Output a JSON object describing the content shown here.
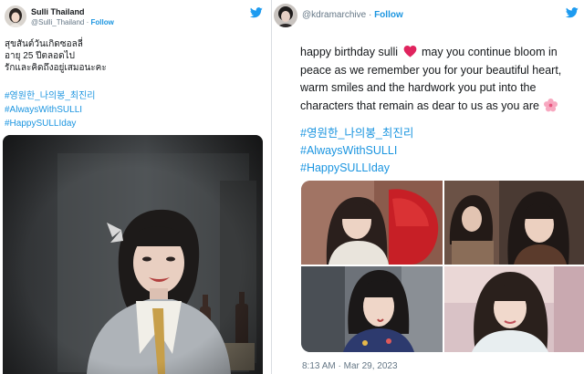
{
  "left_tweet": {
    "display_name": "Sulli Thailand",
    "handle": "@Sulli_Thailand",
    "separator": "·",
    "follow_label": "Follow",
    "lines": [
      "สุขสันต์วันเกิดซอลลี่",
      "อายุ 25 ปีตลอดไป",
      "รักและคิดถึงอยู่เสมอนะคะ"
    ],
    "hashtags": [
      "#영원한_나의봉_최진리",
      "#AlwaysWithSULLI",
      "#HappySULLIday"
    ]
  },
  "right_tweet": {
    "handle": "@kdramarchive",
    "separator": "·",
    "follow_label": "Follow",
    "text": [
      "happy birthday sulli",
      "may you continue bloom in",
      "peace as we remember you for your beautiful heart,",
      "warm smiles and the hardwork you put into the",
      "characters that remain as dear to us as you are"
    ],
    "hashtags": [
      "#영원한_나의봉_최진리",
      "#AlwaysWithSULLI",
      "#HappySULLIday"
    ],
    "time": "8:13 AM",
    "date": "Mar 29, 2023"
  },
  "colors": {
    "link": "#1b95e0",
    "twitter_blue": "#1d9bf0",
    "heart": "#e0245e"
  },
  "icons": [
    "twitter-bird-icon",
    "heart-emoji-icon",
    "cherry-blossom-emoji-icon"
  ]
}
